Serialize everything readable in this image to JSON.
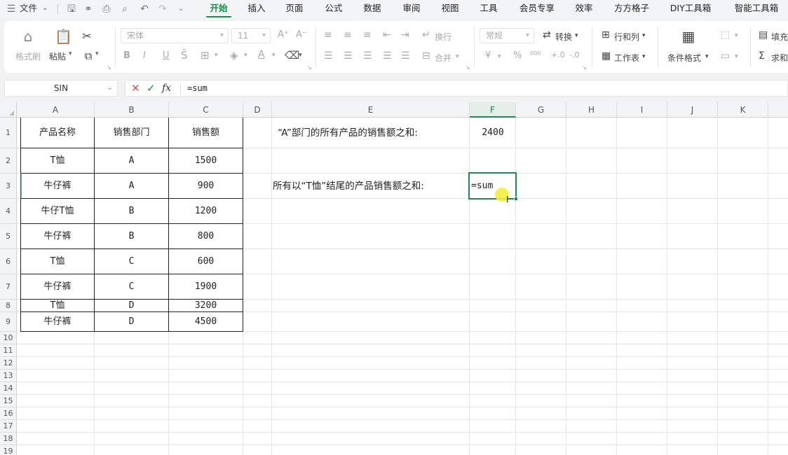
{
  "menubar": {
    "file_label": "文件",
    "tabs": [
      "开始",
      "插入",
      "页面",
      "公式",
      "数据",
      "审阅",
      "视图",
      "工具",
      "会员专享",
      "效率",
      "方方格子",
      "DIY工具箱",
      "智能工具箱"
    ],
    "active_tab": "开始"
  },
  "ribbon": {
    "format_painter": "格式刷",
    "paste": "粘贴",
    "font_name": "宋体",
    "font_size": "11",
    "wrap": "换行",
    "merge": "合并",
    "number_format": "常规",
    "convert": "转换",
    "rows_cols": "行和列",
    "worksheet": "工作表",
    "cond_format": "条件格式",
    "fill": "填充",
    "sum": "求和",
    "bold": "B",
    "italic": "I",
    "underline": "U",
    "font_color": "A",
    "font_grow": "A⁺",
    "font_shrink": "A⁻"
  },
  "formula_bar": {
    "name_box": "SIN",
    "fx": "fx",
    "formula": "=sum"
  },
  "columns": [
    "A",
    "B",
    "C",
    "D",
    "E",
    "F",
    "G",
    "H",
    "I",
    "J",
    "K"
  ],
  "selected_column": "F",
  "rows": [
    "1",
    "2",
    "3",
    "4",
    "5",
    "6",
    "7",
    "8",
    "9",
    "10",
    "11",
    "12",
    "13",
    "14",
    "15",
    "16",
    "17",
    "18",
    "19"
  ],
  "table": {
    "headers": [
      "产品名称",
      "销售部门",
      "销售额"
    ],
    "rows": [
      [
        "T恤",
        "A",
        "1500"
      ],
      [
        "牛仔裤",
        "A",
        "900"
      ],
      [
        "牛仔T恤",
        "B",
        "1200"
      ],
      [
        "牛仔裤",
        "B",
        "800"
      ],
      [
        "T恤",
        "C",
        "600"
      ],
      [
        "牛仔裤",
        "C",
        "1900"
      ],
      [
        "T恤",
        "D",
        "3200"
      ],
      [
        "牛仔裤",
        "D",
        "4500"
      ]
    ]
  },
  "notes": {
    "q1": "“A”部门的所有产品的销售额之和:",
    "a1": "2400",
    "q2": "所有以“T恤”结尾的产品销售额之和:",
    "a2": "=sum"
  },
  "colors": {
    "accent": "#1f8a4c",
    "highlight": "#f3ee3a"
  }
}
